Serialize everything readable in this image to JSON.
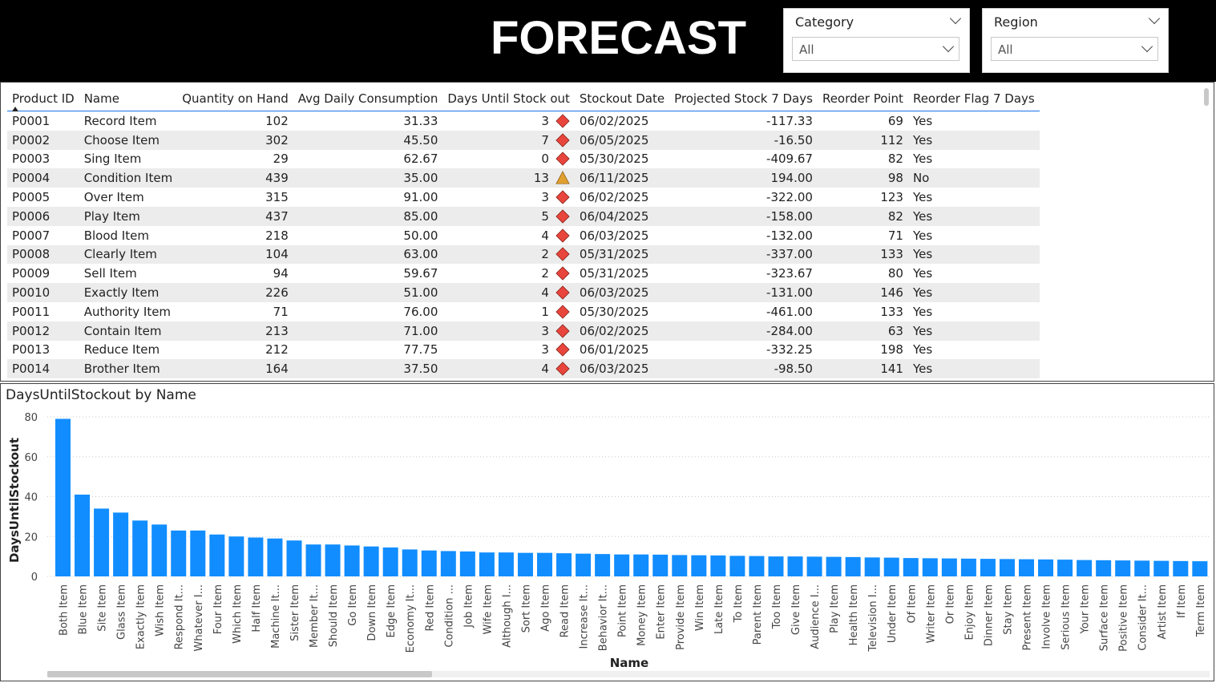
{
  "header": {
    "title": "FORECAST"
  },
  "slicers": [
    {
      "title": "Category",
      "value": "All"
    },
    {
      "title": "Region",
      "value": "All"
    }
  ],
  "colors": {
    "bar": "#118DFF",
    "header_bg": "#000000",
    "diamond": "#E8453C",
    "triangle": "#E0A030"
  },
  "table": {
    "columns": [
      "Product ID",
      "Name",
      "Quantity on Hand",
      "Avg Daily Consumption",
      "Days Until Stock out",
      "Stockout Date",
      "Projected Stock 7 Days",
      "Reorder Point",
      "Reorder Flag 7 Days"
    ],
    "rows": [
      [
        "P0001",
        "Record Item",
        "102",
        "31.33",
        "3",
        "06/02/2025",
        "-117.33",
        "69",
        "Yes",
        "diamond"
      ],
      [
        "P0002",
        "Choose Item",
        "302",
        "45.50",
        "7",
        "06/05/2025",
        "-16.50",
        "112",
        "Yes",
        "diamond"
      ],
      [
        "P0003",
        "Sing Item",
        "29",
        "62.67",
        "0",
        "05/30/2025",
        "-409.67",
        "82",
        "Yes",
        "diamond"
      ],
      [
        "P0004",
        "Condition Item",
        "439",
        "35.00",
        "13",
        "06/11/2025",
        "194.00",
        "98",
        "No",
        "triangle"
      ],
      [
        "P0005",
        "Over Item",
        "315",
        "91.00",
        "3",
        "06/02/2025",
        "-322.00",
        "123",
        "Yes",
        "diamond"
      ],
      [
        "P0006",
        "Play Item",
        "437",
        "85.00",
        "5",
        "06/04/2025",
        "-158.00",
        "82",
        "Yes",
        "diamond"
      ],
      [
        "P0007",
        "Blood Item",
        "218",
        "50.00",
        "4",
        "06/03/2025",
        "-132.00",
        "71",
        "Yes",
        "diamond"
      ],
      [
        "P0008",
        "Clearly Item",
        "104",
        "63.00",
        "2",
        "05/31/2025",
        "-337.00",
        "133",
        "Yes",
        "diamond"
      ],
      [
        "P0009",
        "Sell Item",
        "94",
        "59.67",
        "2",
        "05/31/2025",
        "-323.67",
        "80",
        "Yes",
        "diamond"
      ],
      [
        "P0010",
        "Exactly Item",
        "226",
        "51.00",
        "4",
        "06/03/2025",
        "-131.00",
        "146",
        "Yes",
        "diamond"
      ],
      [
        "P0011",
        "Authority Item",
        "71",
        "76.00",
        "1",
        "05/30/2025",
        "-461.00",
        "133",
        "Yes",
        "diamond"
      ],
      [
        "P0012",
        "Contain Item",
        "213",
        "71.00",
        "3",
        "06/02/2025",
        "-284.00",
        "63",
        "Yes",
        "diamond"
      ],
      [
        "P0013",
        "Reduce Item",
        "212",
        "77.75",
        "3",
        "06/01/2025",
        "-332.25",
        "198",
        "Yes",
        "diamond"
      ],
      [
        "P0014",
        "Brother Item",
        "164",
        "37.50",
        "4",
        "06/03/2025",
        "-98.50",
        "141",
        "Yes",
        "diamond"
      ]
    ]
  },
  "chart_data": {
    "type": "bar",
    "title": "DaysUntilStockout by Name",
    "xlabel": "Name",
    "ylabel": "DaysUntilStockout",
    "ylim": [
      0,
      80
    ],
    "yticks": [
      0,
      20,
      40,
      60,
      80
    ],
    "grid": true,
    "categories": [
      "Both Item",
      "Blue Item",
      "Site Item",
      "Glass Item",
      "Exactly Item",
      "Wish Item",
      "Respond It...",
      "Whatever I...",
      "Four Item",
      "Which Item",
      "Half Item",
      "Machine It...",
      "Sister Item",
      "Member It...",
      "Should Item",
      "Go Item",
      "Down Item",
      "Edge Item",
      "Economy It...",
      "Red Item",
      "Condition ...",
      "Job Item",
      "Wife Item",
      "Although I...",
      "Sort Item",
      "Ago Item",
      "Read Item",
      "Increase It...",
      "Behavior It...",
      "Point Item",
      "Money Item",
      "Enter Item",
      "Provide Item",
      "Win Item",
      "Late Item",
      "To Item",
      "Parent Item",
      "Too Item",
      "Give Item",
      "Audience I...",
      "Play Item",
      "Health Item",
      "Television I...",
      "Under Item",
      "Of Item",
      "Writer Item",
      "Or Item",
      "Enjoy Item",
      "Dinner Item",
      "Stay Item",
      "Present Item",
      "Involve Item",
      "Serious Item",
      "Your Item",
      "Surface Item",
      "Positive Item",
      "Consider It...",
      "Artist Item",
      "If Item",
      "Term Item"
    ],
    "values": [
      79,
      41,
      34,
      32,
      28,
      26,
      23,
      23,
      21,
      20,
      19.5,
      19,
      18,
      16,
      16,
      15.5,
      15,
      14.5,
      13.5,
      13,
      12.7,
      12.5,
      12,
      12,
      11.8,
      11.8,
      11.6,
      11.4,
      11.2,
      11,
      11,
      10.9,
      10.7,
      10.6,
      10.5,
      10.3,
      10.2,
      10,
      10,
      9.9,
      9.8,
      9.7,
      9.5,
      9.4,
      9.2,
      9.1,
      9,
      8.9,
      8.8,
      8.7,
      8.6,
      8.5,
      8.4,
      8.2,
      8.1,
      8,
      7.9,
      7.8,
      7.7,
      7.6
    ]
  }
}
